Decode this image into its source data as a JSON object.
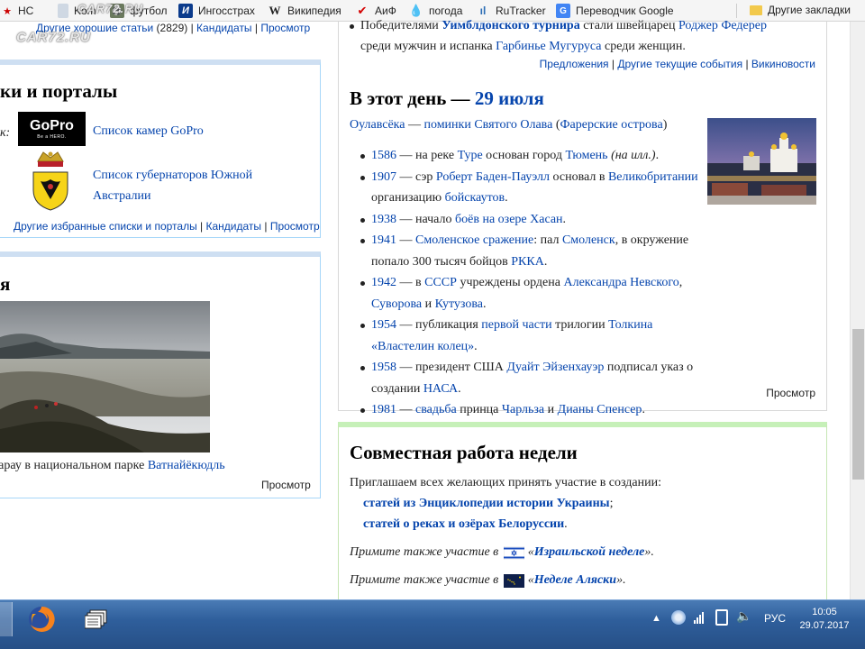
{
  "watermark": "CAR72.RU",
  "bookmarks": [
    {
      "name": "hc",
      "label": "HC",
      "icon": "bookmark-hc-icon"
    },
    {
      "name": "kom",
      "label": "Kom",
      "icon": "bookmark-kom-icon"
    },
    {
      "name": "football",
      "label": "футбол",
      "icon": "football-icon"
    },
    {
      "name": "ingosstrakh",
      "label": "Ингосстрах",
      "icon": "ingosstrakh-icon"
    },
    {
      "name": "wikipedia",
      "label": "Википедия",
      "icon": "wikipedia-icon"
    },
    {
      "name": "aif",
      "label": "АиФ",
      "icon": "aif-icon"
    },
    {
      "name": "weather",
      "label": "погода",
      "icon": "weather-icon"
    },
    {
      "name": "rutracker",
      "label": "RuTracker",
      "icon": "rutracker-icon"
    },
    {
      "name": "translate",
      "label": "Переводчик Google",
      "icon": "google-translate-icon"
    },
    {
      "name": "other",
      "label": "Другие закладки",
      "icon": "folder-icon"
    }
  ],
  "left": {
    "top_links": {
      "good": "Другие хорошие статьи",
      "good_count": "(2829)",
      "candidates": "Кандидаты",
      "view": "Просмотр"
    },
    "lists": {
      "heading": "ки и порталы",
      "prefix": "ок:",
      "gopro_logo": "GoPro",
      "gopro_logo_sub": "Be a HERO.",
      "item1": "Список камер GoPro",
      "item2a": "Список губернаторов Южной",
      "item2b": "Австралии",
      "more": "Другие избранные списки и порталы",
      "candidates": "Кандидаты",
      "view": "Просмотр"
    },
    "photo": {
      "heading": "я",
      "caption_text": "дарау в национальном парке ",
      "caption_link": "Ватнайёкюдль",
      "view": "Просмотр"
    }
  },
  "right": {
    "news": {
      "line1a": "Победителями ",
      "line1b": "Уимблдонского турнира",
      "line1c": " стали швейцарец ",
      "line1d": "Роджер Федерер",
      "line2a": "среди мужчин и испанка ",
      "line2b": "Гарбинье Мугуруса",
      "line2c": " среди женщин.",
      "links": [
        "Предложения",
        "Другие текущие события",
        "Викиновости"
      ]
    },
    "on_this_day": {
      "heading_text": "В этот день — ",
      "heading_date": "29 июля",
      "intro_a": "Оулавсёка",
      "intro_b": " — ",
      "intro_c": "поминки Святого Олава",
      "intro_d": " (",
      "intro_e": "Фарерские острова",
      "intro_f": ")",
      "view": "Просмотр"
    },
    "collab": {
      "heading": "Совместная работа недели",
      "intro": "Приглашаем всех желающих принять участие в создании:",
      "item1": "статей из Энциклопедии истории Украины",
      "item1_suffix": ";",
      "item2": "статей о реках и озёрах Белоруссии",
      "item2_suffix": ".",
      "also_prefix": "Примите также участие в ",
      "also1": "Израильской неделе",
      "also2": "Неделе Аляски",
      "quote_open": "«",
      "quote_close": "»."
    }
  },
  "taskbar": {
    "lang": "РУС",
    "time": "10:05",
    "date": "29.07.2017"
  }
}
